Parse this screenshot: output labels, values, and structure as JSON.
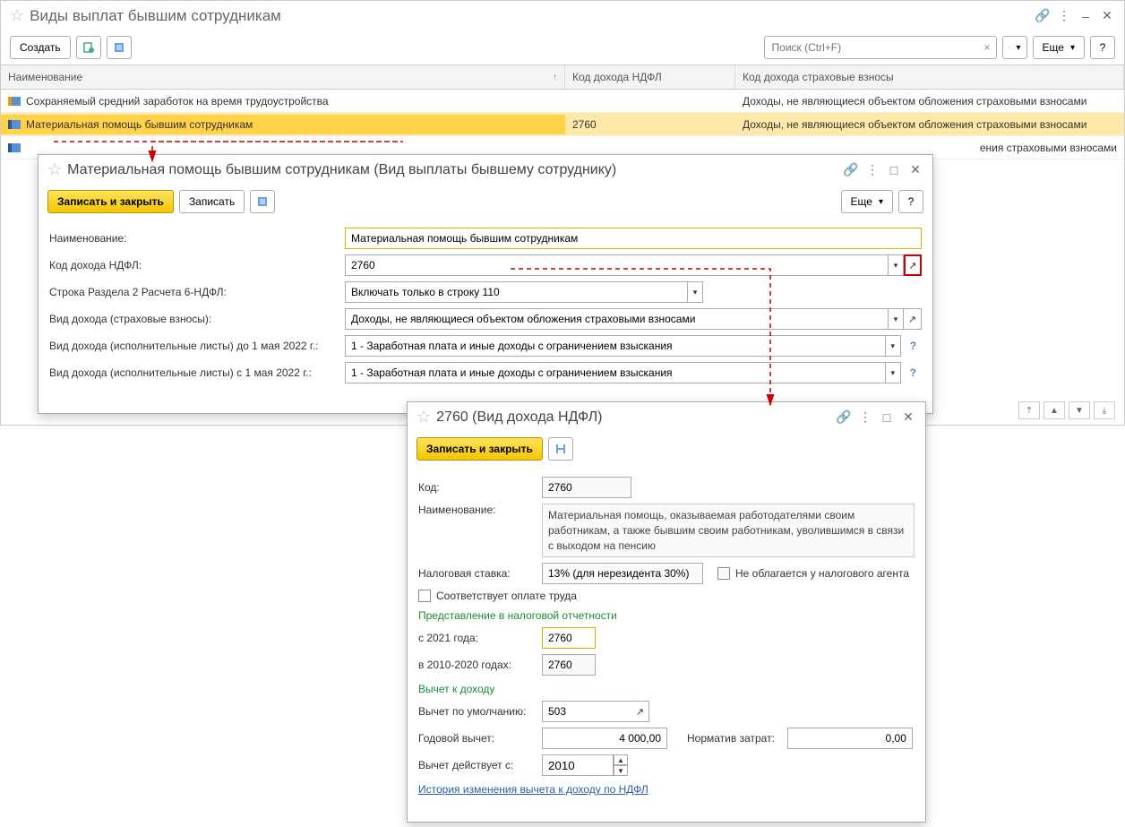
{
  "main": {
    "title": "Виды выплат бывшим сотрудникам",
    "toolbar": {
      "create": "Создать",
      "more": "Еще",
      "search_placeholder": "Поиск (Ctrl+F)"
    },
    "columns": {
      "name": "Наименование",
      "ndfl": "Код дохода НДФЛ",
      "insurance": "Код дохода страховые взносы"
    },
    "rows": [
      {
        "name": "Сохраняемый средний заработок на время трудоустройства",
        "ndfl": "",
        "insurance": "Доходы, не являющиеся объектом обложения страховыми взносами",
        "icon": "orange"
      },
      {
        "name": "Материальная помощь бывшим сотрудникам",
        "ndfl": "2760",
        "insurance": "Доходы, не являющиеся объектом обложения страховыми взносами",
        "icon": "blue"
      },
      {
        "name": "",
        "ndfl": "",
        "insurance": "ения страховыми взносами",
        "icon": "blue"
      }
    ]
  },
  "win2": {
    "title": "Материальная помощь бывшим сотрудникам (Вид выплаты бывшему сотруднику)",
    "save_close": "Записать и закрыть",
    "save": "Записать",
    "more": "Еще",
    "labels": {
      "name": "Наименование:",
      "ndfl": "Код дохода НДФЛ:",
      "row6": "Строка Раздела 2 Расчета 6-НДФЛ:",
      "insurance": "Вид дохода (страховые взносы):",
      "exec_before": "Вид дохода (исполнительные листы) до 1 мая 2022 г.:",
      "exec_after": "Вид дохода (исполнительные листы) с 1 мая 2022 г.:"
    },
    "values": {
      "name": "Материальная помощь бывшим сотрудникам",
      "ndfl": "2760",
      "row6": "Включать только в строку 110",
      "insurance": "Доходы, не являющиеся объектом обложения страховыми взносами",
      "exec_before": "1 - Заработная плата и иные доходы с ограничением взыскания",
      "exec_after": "1 - Заработная плата и иные доходы с ограничением взыскания"
    }
  },
  "win3": {
    "title": "2760 (Вид дохода НДФЛ)",
    "save_close": "Записать и закрыть",
    "labels": {
      "code": "Код:",
      "name": "Наименование:",
      "rate": "Налоговая ставка:",
      "not_taxed": "Не облагается у налогового агента",
      "corresponds": "Соответствует оплате труда",
      "section1": "Представление в налоговой отчетности",
      "from2021": "с 2021 года:",
      "in2010": "в 2010-2020 годах:",
      "section2": "Вычет к доходу",
      "deduction": "Вычет по умолчанию:",
      "annual": "Годовой вычет:",
      "norm": "Норматив затрат:",
      "valid_from": "Вычет действует с:",
      "history": "История изменения вычета к доходу по НДФЛ"
    },
    "values": {
      "code": "2760",
      "name": "Материальная помощь, оказываемая работодателями своим работникам, а также бывшим своим работникам, уволившимся в связи с выходом на пенсию",
      "rate": "13% (для нерезидента 30%)",
      "from2021": "2760",
      "in2010": "2760",
      "deduction": "503",
      "annual": "4 000,00",
      "norm": "0,00",
      "valid_from": "2010"
    }
  }
}
